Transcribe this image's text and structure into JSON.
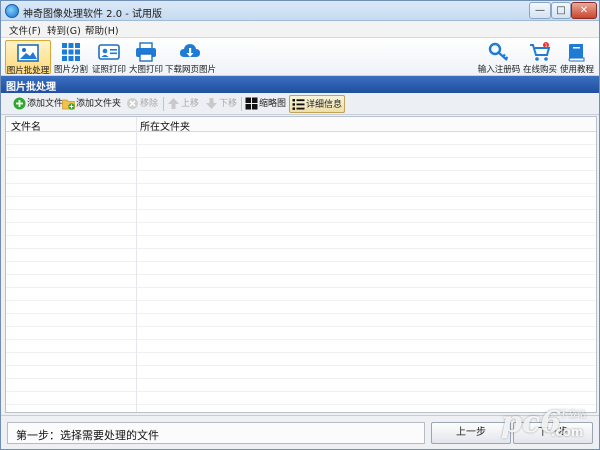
{
  "window": {
    "title": "神奇图像处理软件 2.0 - 试用版",
    "controls": {
      "minimize": "—",
      "maximize": "□",
      "close": "✕"
    }
  },
  "menu": [
    {
      "label": "文件(F)"
    },
    {
      "label": "转到(G)"
    },
    {
      "label": "帮助(H)"
    }
  ],
  "toolbar": {
    "left": [
      {
        "label": "图片批处理",
        "icon": "image-icon",
        "active": true
      },
      {
        "label": "图片分割",
        "icon": "grid-split-icon"
      },
      {
        "label": "证照打印",
        "icon": "id-card-icon"
      },
      {
        "label": "大图打印",
        "icon": "printer-icon"
      },
      {
        "label": "下载网页图片",
        "icon": "cloud-download-icon"
      }
    ],
    "right": [
      {
        "label": "输入注册码",
        "icon": "key-icon"
      },
      {
        "label": "在线购买",
        "icon": "cart-icon",
        "badge": "1"
      },
      {
        "label": "使用教程",
        "icon": "book-icon"
      }
    ]
  },
  "section": {
    "title": "图片批处理"
  },
  "actions": [
    {
      "label": "添加文件",
      "icon": "add-file-icon"
    },
    {
      "label": "添加文件夹",
      "icon": "add-folder-icon"
    },
    {
      "label": "移除",
      "icon": "remove-icon",
      "disabled": true
    },
    {
      "label": "上移",
      "icon": "arrow-up-icon",
      "disabled": true
    },
    {
      "label": "下移",
      "icon": "arrow-down-icon",
      "disabled": true
    },
    {
      "label": "缩略图",
      "icon": "thumbnail-view-icon"
    },
    {
      "label": "详细信息",
      "icon": "details-view-icon",
      "pressed": true
    }
  ],
  "list": {
    "columns": [
      "文件名",
      "所在文件夹"
    ]
  },
  "status": {
    "step": "第一步：选择需要处理的文件",
    "prev_label": "上一步",
    "next_label": "下一步"
  },
  "watermark": {
    "letters": "pc6",
    "cn": "下载站",
    "domain": ".com"
  },
  "colors": {
    "section_header": "#2a5cae",
    "active_tool": "#ffd97a",
    "accent_blue": "#1e7bd6"
  }
}
